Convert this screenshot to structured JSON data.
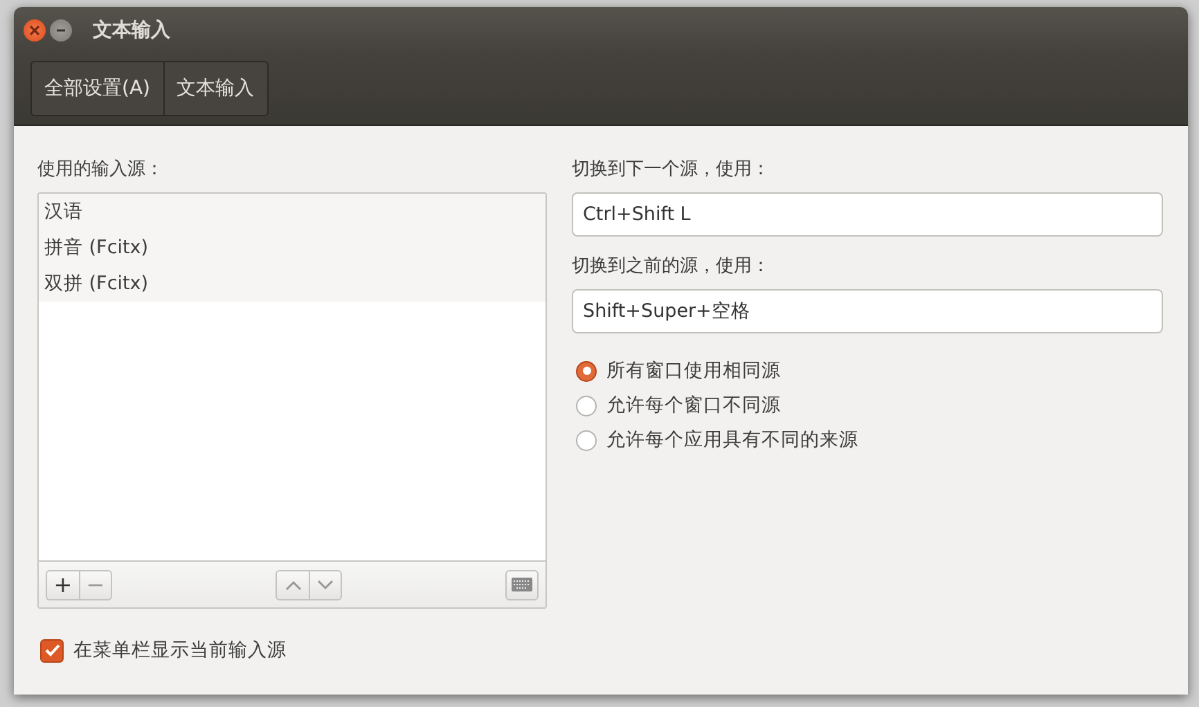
{
  "window": {
    "title": "文本输入"
  },
  "breadcrumbs": [
    {
      "label": "全部设置(A)"
    },
    {
      "label": "文本输入"
    }
  ],
  "sources": {
    "label": "使用的输入源：",
    "items": [
      {
        "label": "汉语"
      },
      {
        "label": "拼音 (Fcitx)"
      },
      {
        "label": "双拼 (Fcitx)"
      }
    ],
    "add": "+",
    "remove": "−"
  },
  "shortcuts": [
    {
      "label": "切换到下一个源，使用：",
      "value": "Ctrl+Shift L"
    },
    {
      "label": "切换到之前的源，使用：",
      "value": "Shift+Super+空格"
    }
  ],
  "modes": [
    {
      "label": "所有窗口使用相同源",
      "selected": true
    },
    {
      "label": "允许每个窗口不同源",
      "selected": false
    },
    {
      "label": "允许每个应用具有不同的来源",
      "selected": false
    }
  ],
  "show_in_menubar": {
    "label": "在菜单栏显示当前输入源",
    "checked": true
  }
}
